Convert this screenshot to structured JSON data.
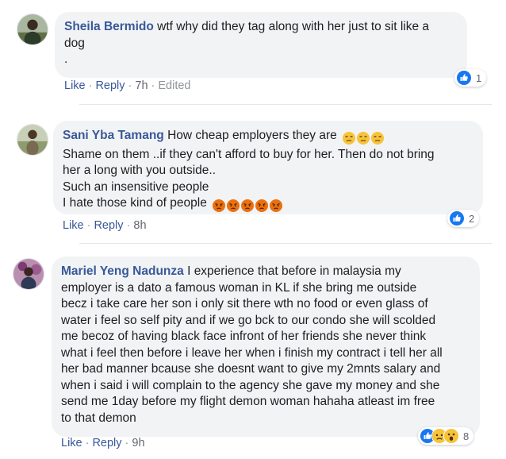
{
  "colors": {
    "bubble_bg": "#f2f3f5",
    "name_blue": "#385898",
    "like_blue": "#1877f2",
    "angry_orange": "#e9710f"
  },
  "comments": [
    {
      "author": "Sheila Bermido",
      "lines": [
        "wtf why did they tag along with her just to sit like a",
        "dog",
        "."
      ],
      "actions": {
        "like": "Like",
        "reply": "Reply",
        "time": "7h",
        "edited": "Edited"
      },
      "reactions": {
        "icons": [
          "like-icon"
        ],
        "count": "1"
      }
    },
    {
      "author": "Sani Yba Tamang",
      "lines": [
        "How cheap employers they are",
        "Shame on them ..if they can't afford to buy for her. Then do not bring",
        "her a long with you outside..",
        "Such an insensitive people",
        "I hate those kind of people"
      ],
      "inline_emojis": {
        "line1": [
          "unamused-face",
          "unamused-face",
          "unamused-face"
        ],
        "line5": [
          "angry-face",
          "angry-face",
          "angry-face",
          "angry-face",
          "angry-face"
        ]
      },
      "actions": {
        "like": "Like",
        "reply": "Reply",
        "time": "8h"
      },
      "reactions": {
        "icons": [
          "like-icon"
        ],
        "count": "2"
      }
    },
    {
      "author": "Mariel Yeng Nadunza",
      "lines": [
        "I experience that before in malaysia my",
        "employer is a dato a famous woman in KL if she bring me outside",
        "becz i take care her son i only sit there wth no food or even glass of",
        "water i feel so self pity and if we go bck to our condo she will scolded",
        "me becoz of having black face infront of her friends she never think",
        "what i feel then before i leave her when i finish my contract i tell her all",
        "her bad manner bcause she doesnt want to give my 2mnts salary and",
        "when i said i will complain to the agency she gave my money and she",
        "send me 1day before my flight demon woman hahaha atleast im free",
        "to that demon"
      ],
      "actions": {
        "like": "Like",
        "reply": "Reply",
        "time": "9h"
      },
      "reactions": {
        "icons": [
          "like-icon",
          "sad-icon",
          "wow-icon"
        ],
        "count": "8"
      }
    }
  ]
}
